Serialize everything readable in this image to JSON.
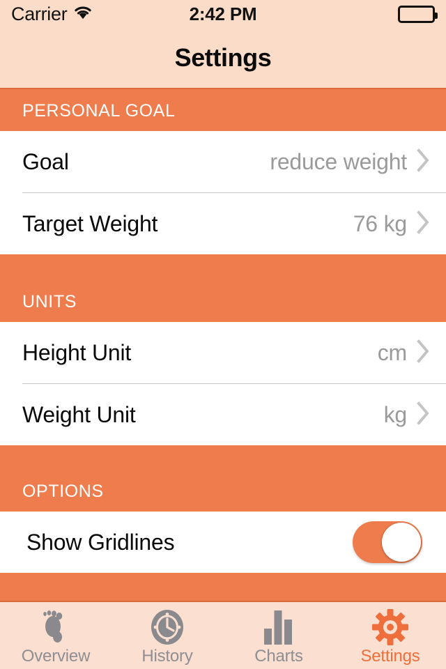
{
  "status_bar": {
    "carrier": "Carrier",
    "wifi_icon": "wifi-icon",
    "time": "2:42 PM",
    "battery_icon": "battery-full-icon"
  },
  "nav": {
    "title": "Settings"
  },
  "theme": {
    "accent": "#ee7c4d",
    "nav_background": "#fbdcc9",
    "tab_background": "#fbdfd0",
    "cell_background": "#ffffff",
    "value_text": "#9a9a9a",
    "title_text": "#0a0a0a",
    "header_text": "#ffffff",
    "tab_inactive": "#8e8e93",
    "tab_active": "#ee6f3c"
  },
  "sections": [
    {
      "header": "PERSONAL GOAL",
      "rows": [
        {
          "title": "Goal",
          "value": "reduce weight",
          "accessory": "chevron-right-icon"
        },
        {
          "title": "Target Weight",
          "value": "76 kg",
          "accessory": "chevron-right-icon"
        }
      ]
    },
    {
      "header": "UNITS",
      "rows": [
        {
          "title": "Height Unit",
          "value": "cm",
          "accessory": "chevron-right-icon"
        },
        {
          "title": "Weight Unit",
          "value": "kg",
          "accessory": "chevron-right-icon"
        }
      ]
    },
    {
      "header": "OPTIONS",
      "rows": [
        {
          "title": "Show Gridlines",
          "value": "",
          "accessory": "toggle-switch",
          "toggle_on": true
        }
      ]
    }
  ],
  "tab_bar": {
    "items": [
      {
        "label": "Overview",
        "icon": "footprint-icon",
        "active": false
      },
      {
        "label": "History",
        "icon": "clock-icon",
        "active": false
      },
      {
        "label": "Charts",
        "icon": "bar-chart-icon",
        "active": false
      },
      {
        "label": "Settings",
        "icon": "gear-icon",
        "active": true
      }
    ]
  }
}
